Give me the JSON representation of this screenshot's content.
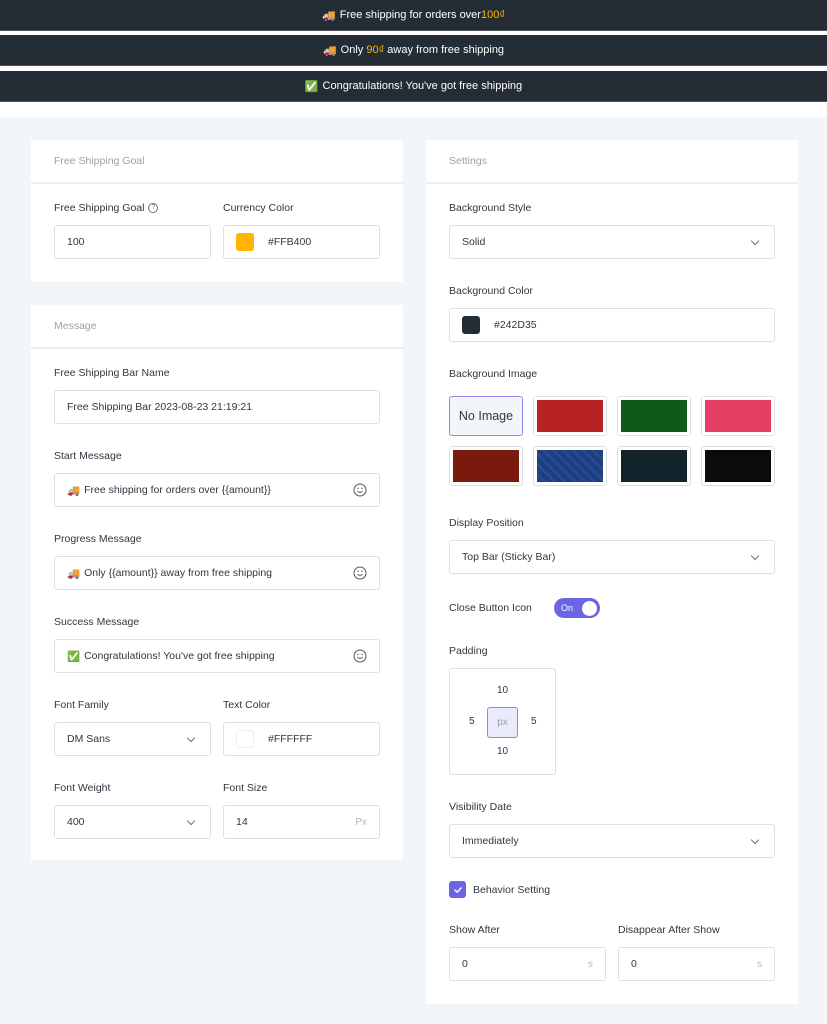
{
  "preview": {
    "start": {
      "emoji": "🚚",
      "text": "Free shipping for orders over ",
      "amount": "100₫",
      "suffix": ""
    },
    "progress": {
      "emoji": "🚚",
      "text": "Only ",
      "amount": "90₫",
      "suffix": " away from free shipping"
    },
    "success": {
      "emoji": "✅",
      "text": "Congratulations! You've got free shipping"
    }
  },
  "goal_card": {
    "title": "Free Shipping Goal",
    "goal_label": "Free Shipping Goal",
    "goal_value": "100",
    "currency_color_label": "Currency Color",
    "currency_color_value": "#FFB400",
    "currency_color_swatch": "#FFB400"
  },
  "message_card": {
    "title": "Message",
    "bar_name_label": "Free Shipping Bar Name",
    "bar_name_value": "Free Shipping Bar 2023-08-23 21:19:21",
    "start_label": "Start Message",
    "start_emoji": "🚚",
    "start_value": "Free shipping for orders over {{amount}}",
    "progress_label": "Progress Message",
    "progress_emoji": "🚚",
    "progress_value": "Only {{amount}} away from free shipping",
    "success_label": "Success Message",
    "success_emoji": "✅",
    "success_value": "Congratulations! You've got free shipping",
    "font_family_label": "Font Family",
    "font_family_value": "DM Sans",
    "text_color_label": "Text Color",
    "text_color_value": "#FFFFFF",
    "text_color_swatch": "#FFFFFF",
    "font_weight_label": "Font Weight",
    "font_weight_value": "400",
    "font_size_label": "Font Size",
    "font_size_value": "14",
    "font_size_unit": "Px"
  },
  "settings_card": {
    "title": "Settings",
    "bg_style_label": "Background Style",
    "bg_style_value": "Solid",
    "bg_color_label": "Background Color",
    "bg_color_value": "#242D35",
    "bg_color_swatch": "#242D35",
    "bg_image_label": "Background Image",
    "bg_images": [
      {
        "name": "No Image",
        "selected": true
      },
      {
        "name": "red-christmas",
        "color": "#B82224"
      },
      {
        "name": "green-christmas",
        "color": "#0E5A17"
      },
      {
        "name": "pink-hearts",
        "color": "#E73E66"
      },
      {
        "name": "dark-red-christmas",
        "color": "#7A1A0E"
      },
      {
        "name": "blue-diamonds",
        "color": "#1E3F80"
      },
      {
        "name": "dark-feathers",
        "color": "#13232C"
      },
      {
        "name": "black-pattern",
        "color": "#0B0B0B"
      }
    ],
    "display_position_label": "Display Position",
    "display_position_value": "Top Bar (Sticky Bar)",
    "close_button_label": "Close Button Icon",
    "close_button_state": "On",
    "padding_label": "Padding",
    "padding": {
      "top": "10",
      "right": "5",
      "bottom": "10",
      "left": "5",
      "unit": "px"
    },
    "visibility_label": "Visibility Date",
    "visibility_value": "Immediately",
    "behavior_label": "Behavior Setting",
    "behavior_checked": true,
    "show_after_label": "Show After",
    "show_after_value": "0",
    "show_after_unit": "s",
    "disappear_label": "Disappear After Show",
    "disappear_value": "0",
    "disappear_unit": "s"
  }
}
